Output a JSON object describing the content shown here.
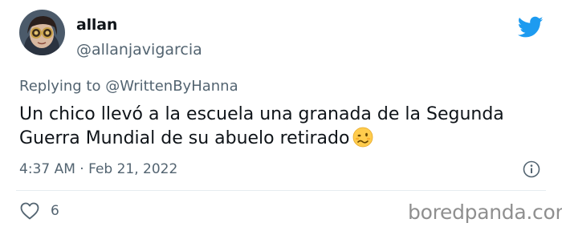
{
  "tweet": {
    "display_name": "allan",
    "handle": "@allanjavigarcia",
    "replying_prefix": "Replying to",
    "replying_to": "@WrittenByHanna",
    "text": "Un chico llevó a la escuela una granada de la Segunda Guerra Mundial de su abuelo retirado",
    "emoji": "woozy-face",
    "time": "4:37 AM",
    "separator": "·",
    "date": "Feb 21, 2022",
    "likes": "6"
  },
  "icons": {
    "bird": "twitter-bird-icon",
    "info": "info-icon",
    "like": "heart-icon"
  },
  "colors": {
    "brand": "#1d9bf0",
    "text": "#0f1419",
    "muted": "#536471",
    "watermark": "#8f8f8f"
  },
  "watermark": "boredpanda.com"
}
